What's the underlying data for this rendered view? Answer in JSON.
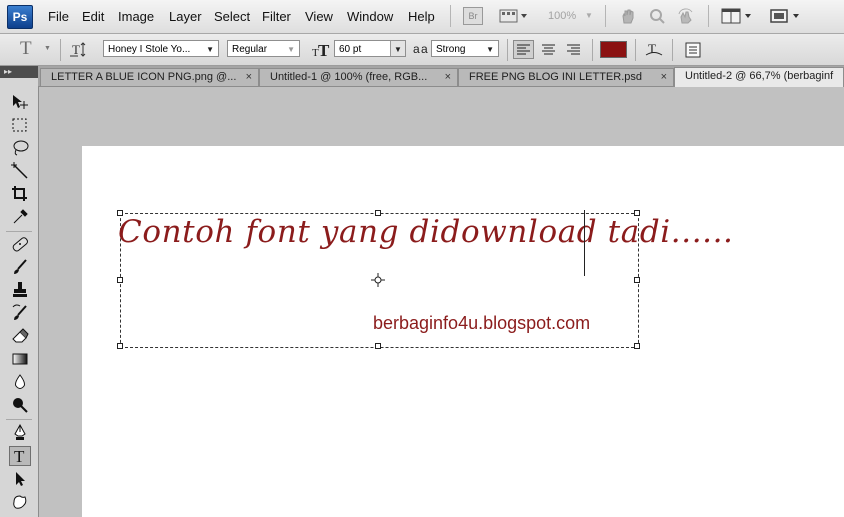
{
  "app": {
    "logo": "Ps"
  },
  "menu": {
    "items": [
      "File",
      "Edit",
      "Image",
      "Layer",
      "Select",
      "Filter",
      "View",
      "Window",
      "Help"
    ],
    "bridge_label": "Br",
    "zoom_level": "100%"
  },
  "options": {
    "tool_glyph": "T",
    "font_family": "Honey I Stole Yo...",
    "font_style": "Regular",
    "font_size": "60 pt",
    "antialias_icon": "a a",
    "antialias": "Strong",
    "text_color": "#8b1212"
  },
  "tabs": [
    {
      "label": "LETTER A BLUE ICON PNG.png @...",
      "close": "×"
    },
    {
      "label": "Untitled-1 @ 100% (free, RGB...",
      "close": "×"
    },
    {
      "label": "FREE PNG BLOG INI LETTER.psd",
      "close": "×"
    },
    {
      "label": "Untitled-2 @ 66,7% (berbaginf",
      "close": ""
    }
  ],
  "toolbox": {
    "grip": "▸▸",
    "tools": [
      "move",
      "marquee",
      "lasso",
      "magic-wand",
      "crop",
      "eyedropper",
      "healing",
      "brush",
      "clone-stamp",
      "history-brush",
      "eraser",
      "gradient",
      "blur",
      "dodge",
      "pen",
      "type",
      "path-select",
      "custom-shape"
    ]
  },
  "canvas": {
    "script_text": "Contoh font yang didownload tadi......",
    "blog_text": "berbaginfo4u.blogspot.com"
  }
}
